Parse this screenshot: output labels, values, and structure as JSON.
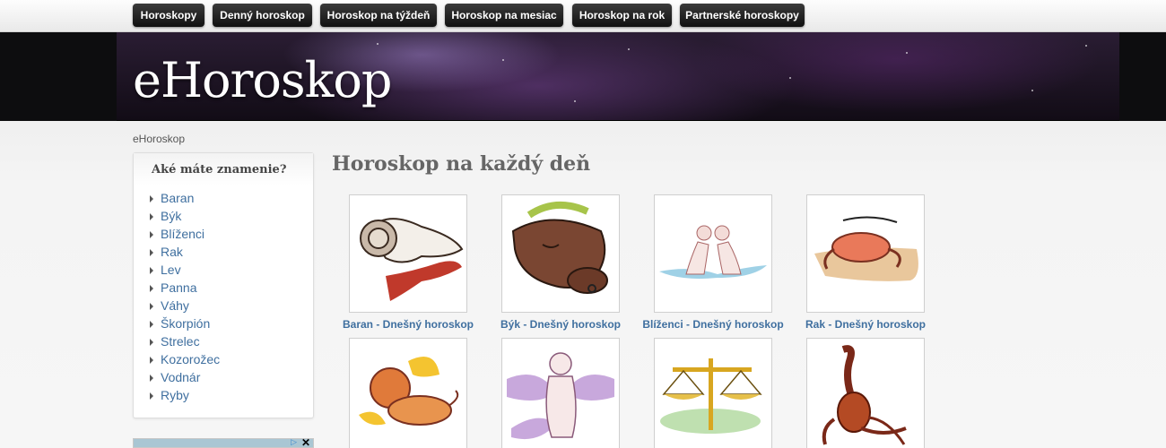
{
  "nav": {
    "items": [
      {
        "label": "Horoskopy"
      },
      {
        "label": "Denný horoskop"
      },
      {
        "label": "Horoskop na týždeň"
      },
      {
        "label": "Horoskop na mesiac"
      },
      {
        "label": "Horoskop na rok"
      },
      {
        "label": "Partnerské horoskopy"
      }
    ]
  },
  "header": {
    "site_title": "eHoroskop"
  },
  "breadcrumb": {
    "text": "eHoroskop"
  },
  "sidebar": {
    "title": "Aké máte znamenie?",
    "signs": [
      "Baran",
      "Býk",
      "Blíženci",
      "Rak",
      "Lev",
      "Panna",
      "Váhy",
      "Škorpión",
      "Strelec",
      "Kozorožec",
      "Vodnár",
      "Ryby"
    ]
  },
  "ad": {
    "adchoices_icon": "adchoices-icon",
    "close": "✕"
  },
  "main": {
    "heading": "Horoskop na každý deň",
    "cards": [
      {
        "caption": "Baran - Dnešný horoskop",
        "icon": "ram-icon"
      },
      {
        "caption": "Býk - Dnešný horoskop",
        "icon": "bull-icon"
      },
      {
        "caption": "Blíženci - Dnešný horoskop",
        "icon": "twins-icon"
      },
      {
        "caption": "Rak - Dnešný horoskop",
        "icon": "crab-icon"
      },
      {
        "caption": "",
        "icon": "lion-icon"
      },
      {
        "caption": "",
        "icon": "virgin-icon"
      },
      {
        "caption": "",
        "icon": "scales-icon"
      },
      {
        "caption": "",
        "icon": "scorpion-icon"
      }
    ]
  },
  "colors": {
    "link": "#3f6f9f",
    "nav_bg": "#1a1a1a",
    "banner": "#2a1d33"
  }
}
